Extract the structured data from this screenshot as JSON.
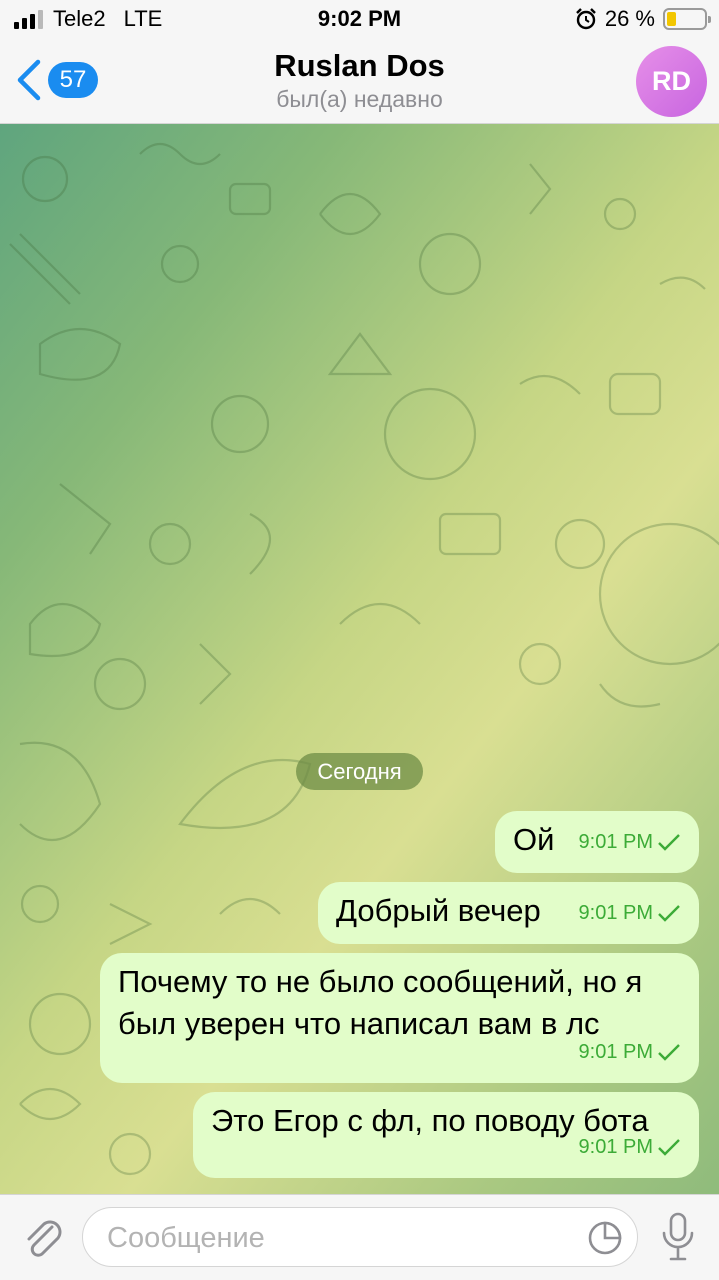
{
  "status_bar": {
    "carrier": "Tele2",
    "network": "LTE",
    "time": "9:02 PM",
    "alarm_icon": "alarm-icon",
    "battery_percent": "26 %",
    "battery_level": 0.26
  },
  "nav": {
    "back_count": "57",
    "title": "Ruslan Dos",
    "subtitle": "был(а) недавно",
    "avatar_initials": "RD"
  },
  "chat": {
    "date_label": "Сегодня",
    "messages": [
      {
        "text": "Ой",
        "time": "9:01 PM"
      },
      {
        "text": "Добрый вечер",
        "time": "9:01 PM"
      },
      {
        "text": "Почему то не было сообщений, но я был уверен что написал вам в лс",
        "time": "9:01 PM"
      },
      {
        "text": "Это Егор с фл, по поводу бота",
        "time": "9:01 PM"
      }
    ]
  },
  "input": {
    "placeholder": "Сообщение"
  },
  "colors": {
    "accent": "#1a8cf0",
    "bubble": "#e2fdc9",
    "check": "#3cab37",
    "avatar": "#d77ae6"
  }
}
